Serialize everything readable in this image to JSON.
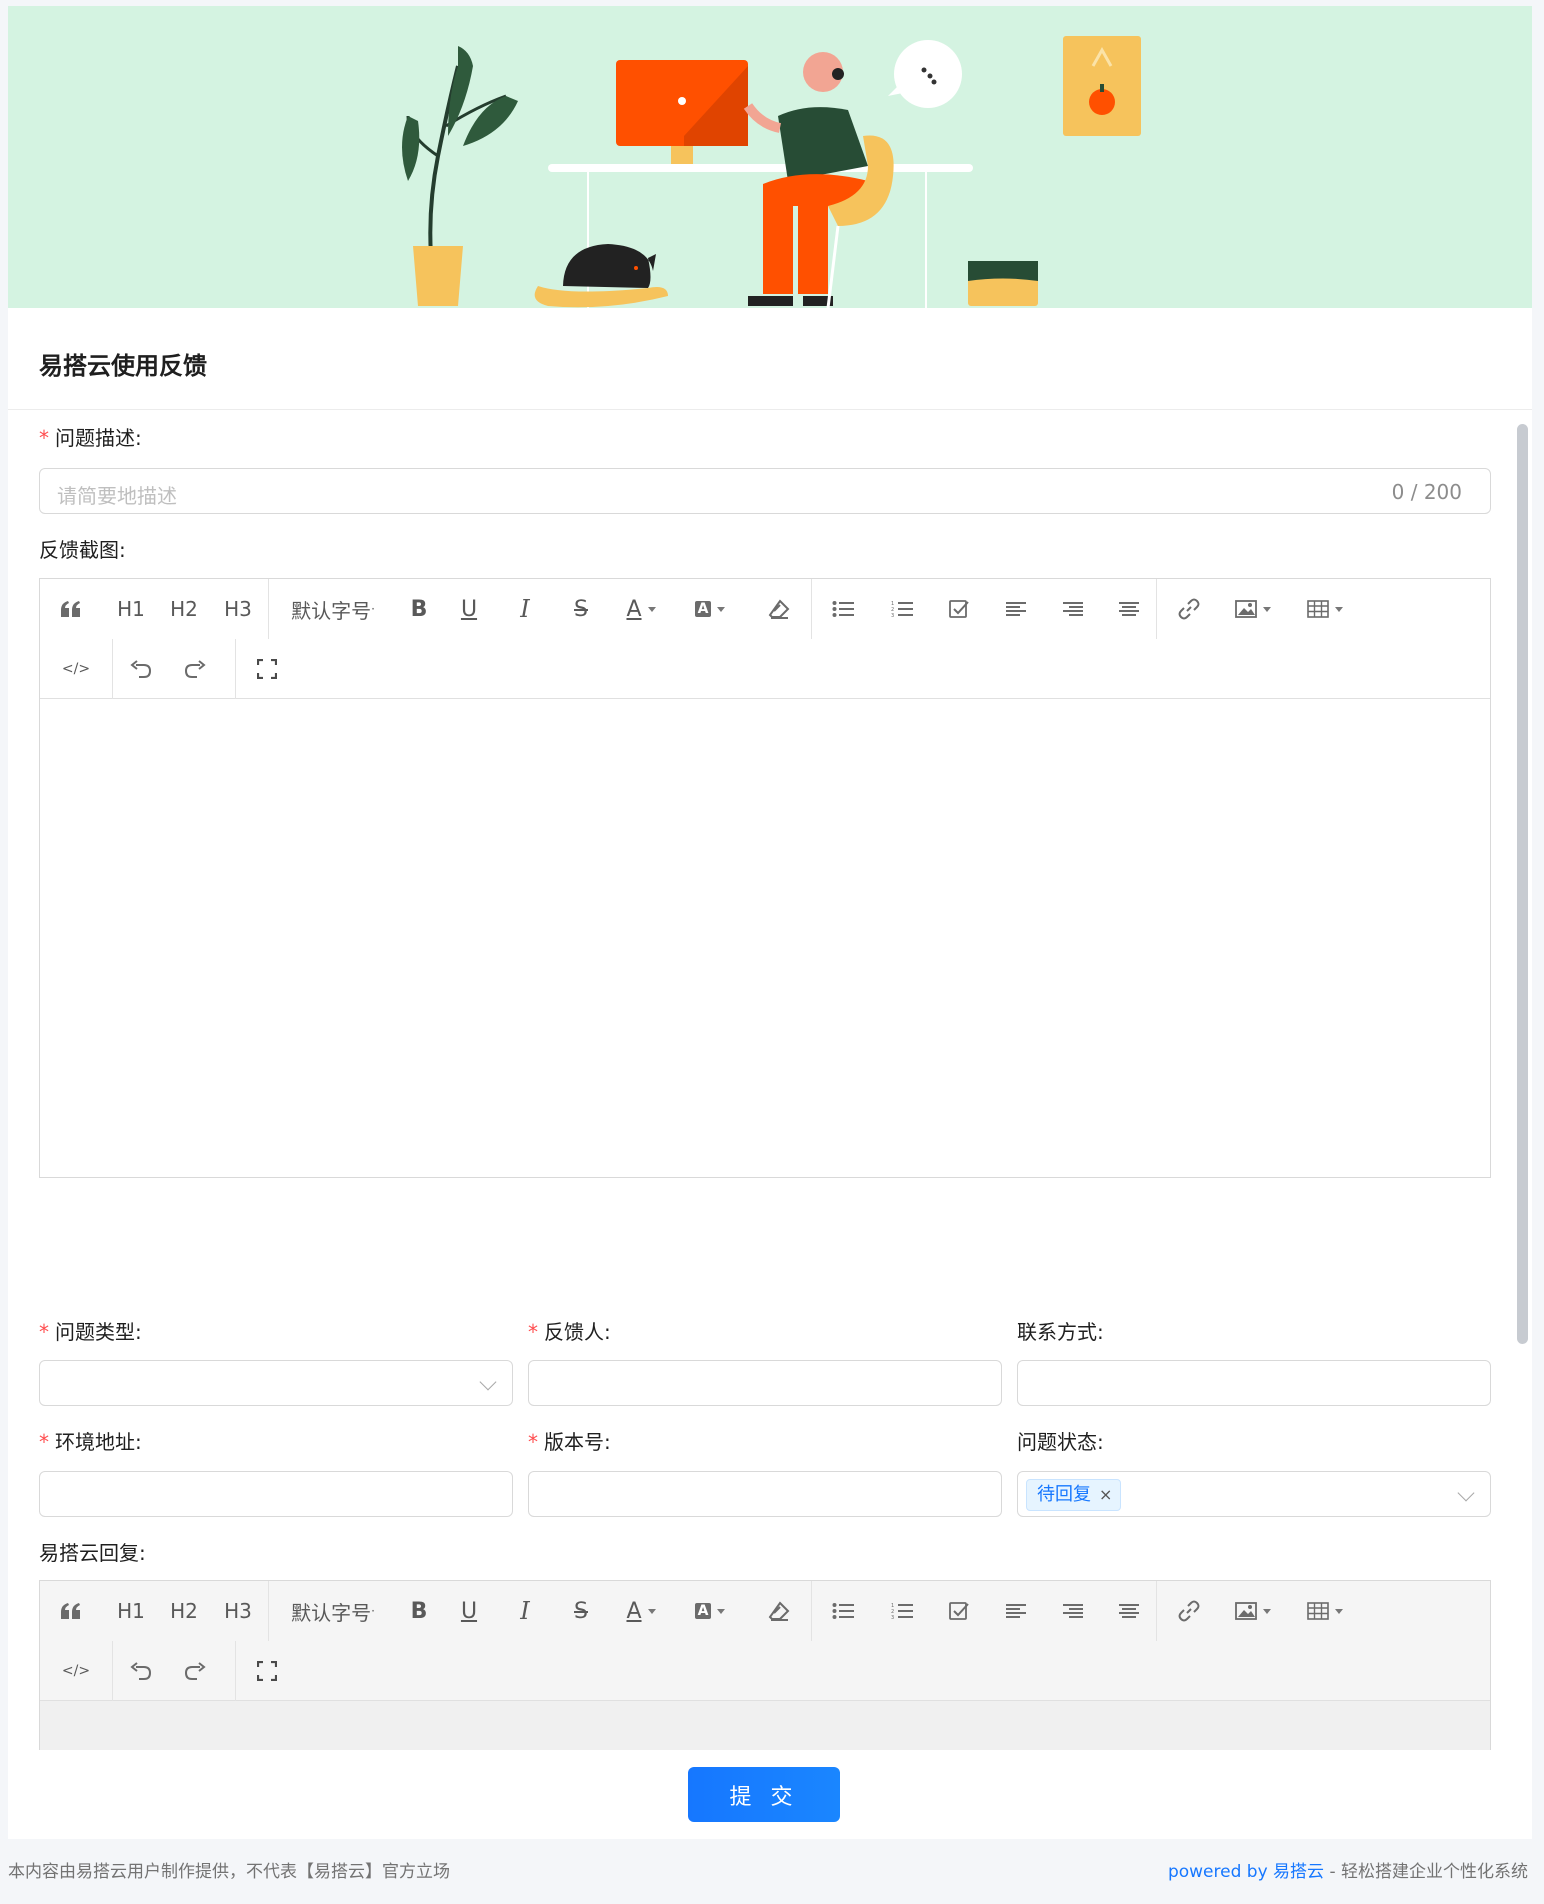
{
  "form": {
    "title": "易搭云使用反馈",
    "submit_label": "提 交"
  },
  "fields": {
    "problem_desc": {
      "label": "问题描述:",
      "placeholder": "请简要地描述",
      "count": "0 / 200"
    },
    "screenshot": {
      "label": "反馈截图:"
    },
    "problem_type": {
      "label": "问题类型:"
    },
    "feedback_person": {
      "label": "反馈人:"
    },
    "contact": {
      "label": "联系方式:"
    },
    "env_address": {
      "label": "环境地址:"
    },
    "version": {
      "label": "版本号:"
    },
    "problem_status": {
      "label": "问题状态:",
      "tag": "待回复",
      "tag_close": "×"
    },
    "reply": {
      "label": "易搭云回复:"
    }
  },
  "toolbar": {
    "h1": "H1",
    "h2": "H2",
    "h3": "H3",
    "font_size": "默认字号"
  },
  "footer": {
    "left": "本内容由易搭云用户制作提供，不代表【易搭云】官方立场",
    "powered_by": "powered by 易搭云",
    "tagline": " - 轻松搭建企业个性化系统"
  },
  "colors": {
    "banner_bg": "#d4f3e1",
    "primary": "#1677ff",
    "required": "#ff4d4f"
  }
}
